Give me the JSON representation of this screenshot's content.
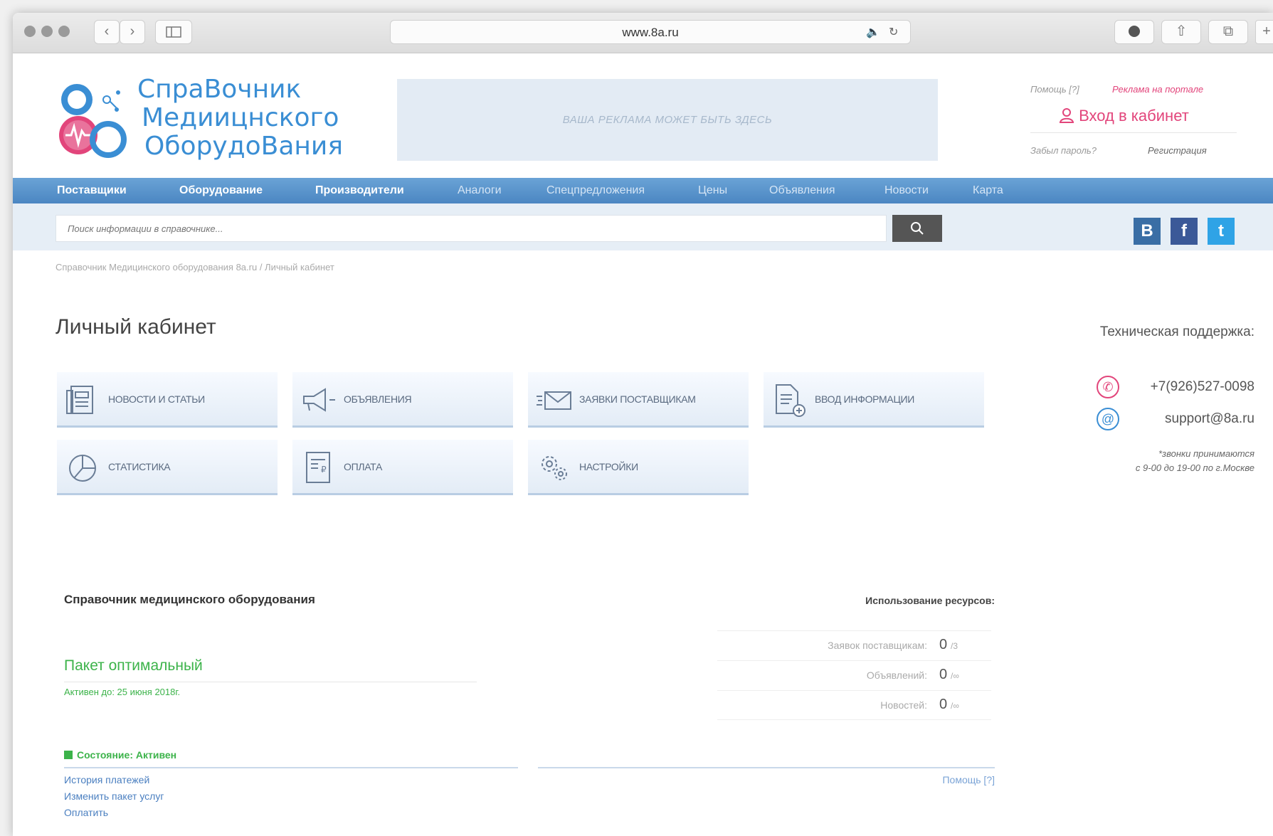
{
  "browser": {
    "url": "www.8a.ru",
    "back_icon": "chevron-left-icon",
    "forward_icon": "chevron-right-icon",
    "sidebar_icon": "sidebar-icon",
    "audio_icon": "speaker-icon",
    "reload_icon": "reload-icon",
    "download_icon": "download-icon",
    "share_icon": "share-icon",
    "tabs_icon": "tabs-icon",
    "new_tab": "+"
  },
  "header": {
    "logo_lines": [
      "СпраВочник",
      "Медиицнского",
      "ОборудоВания"
    ],
    "banner_text": "ВАША РЕКЛАМА МОЖЕТ БЫТЬ ЗДЕСЬ",
    "help_link": "Помощь [?]",
    "ads_link": "Реклама на портале",
    "login": "Вход в кабинет",
    "forgot": "Забыл пароль?",
    "register": "Регистрация"
  },
  "nav": {
    "items": [
      "Поставщики",
      "Оборудование",
      "Производители",
      "Аналоги",
      "Спецпредложения",
      "Цены",
      "Объявления",
      "Новости",
      "Карта"
    ]
  },
  "search": {
    "placeholder": "Поиск информации в справочнике...",
    "icon": "search-icon"
  },
  "social": [
    "В",
    "f",
    "t"
  ],
  "breadcrumb": "Справочник Медицинского оборудования 8a.ru / Личный кабинет",
  "page": {
    "title": "Личный кабинет",
    "tiles": [
      {
        "label": "Новости и статьи",
        "icon": "news-icon"
      },
      {
        "label": "Объявления",
        "icon": "megaphone-icon"
      },
      {
        "label": "Заявки поставщикам",
        "icon": "envelope-icon"
      },
      {
        "label": "Ввод информации",
        "icon": "document-add-icon"
      },
      {
        "label": "Статистика",
        "icon": "pie-chart-icon"
      },
      {
        "label": "Оплата",
        "icon": "invoice-icon"
      },
      {
        "label": "Настройки",
        "icon": "gears-icon"
      }
    ]
  },
  "support": {
    "title": "Техническая поддержка:",
    "phone": "+7(926)527-0098",
    "email": "support@8a.ru",
    "note_line1": "*звонки принимаются",
    "note_line2": "с 9-00 до 19-00 по г.Москве",
    "colors": {
      "phone": "#e2457b",
      "email": "#3a8ed4"
    }
  },
  "package": {
    "section_title": "Справочник медицинского оборудования",
    "name": "Пакет оптимальный",
    "active_until": "Активен до: 25 июня 2018г.",
    "state": "Состояние: Активен",
    "links": [
      "История платежей",
      "Изменить пакет услуг",
      "Оплатить"
    ]
  },
  "resources": {
    "title": "Использование ресурсов:",
    "rows": [
      {
        "label": "Заявок поставщикам:",
        "value": "0",
        "max": "/3"
      },
      {
        "label": "Объявлений:",
        "value": "0",
        "max": "/∞"
      },
      {
        "label": "Новостей:",
        "value": "0",
        "max": "/∞"
      }
    ],
    "help": "Помощь [?]"
  },
  "colors": {
    "accent": "#3a8ed4",
    "pink": "#e2457b",
    "green": "#3cb34a",
    "nav": "#5a96cf"
  }
}
